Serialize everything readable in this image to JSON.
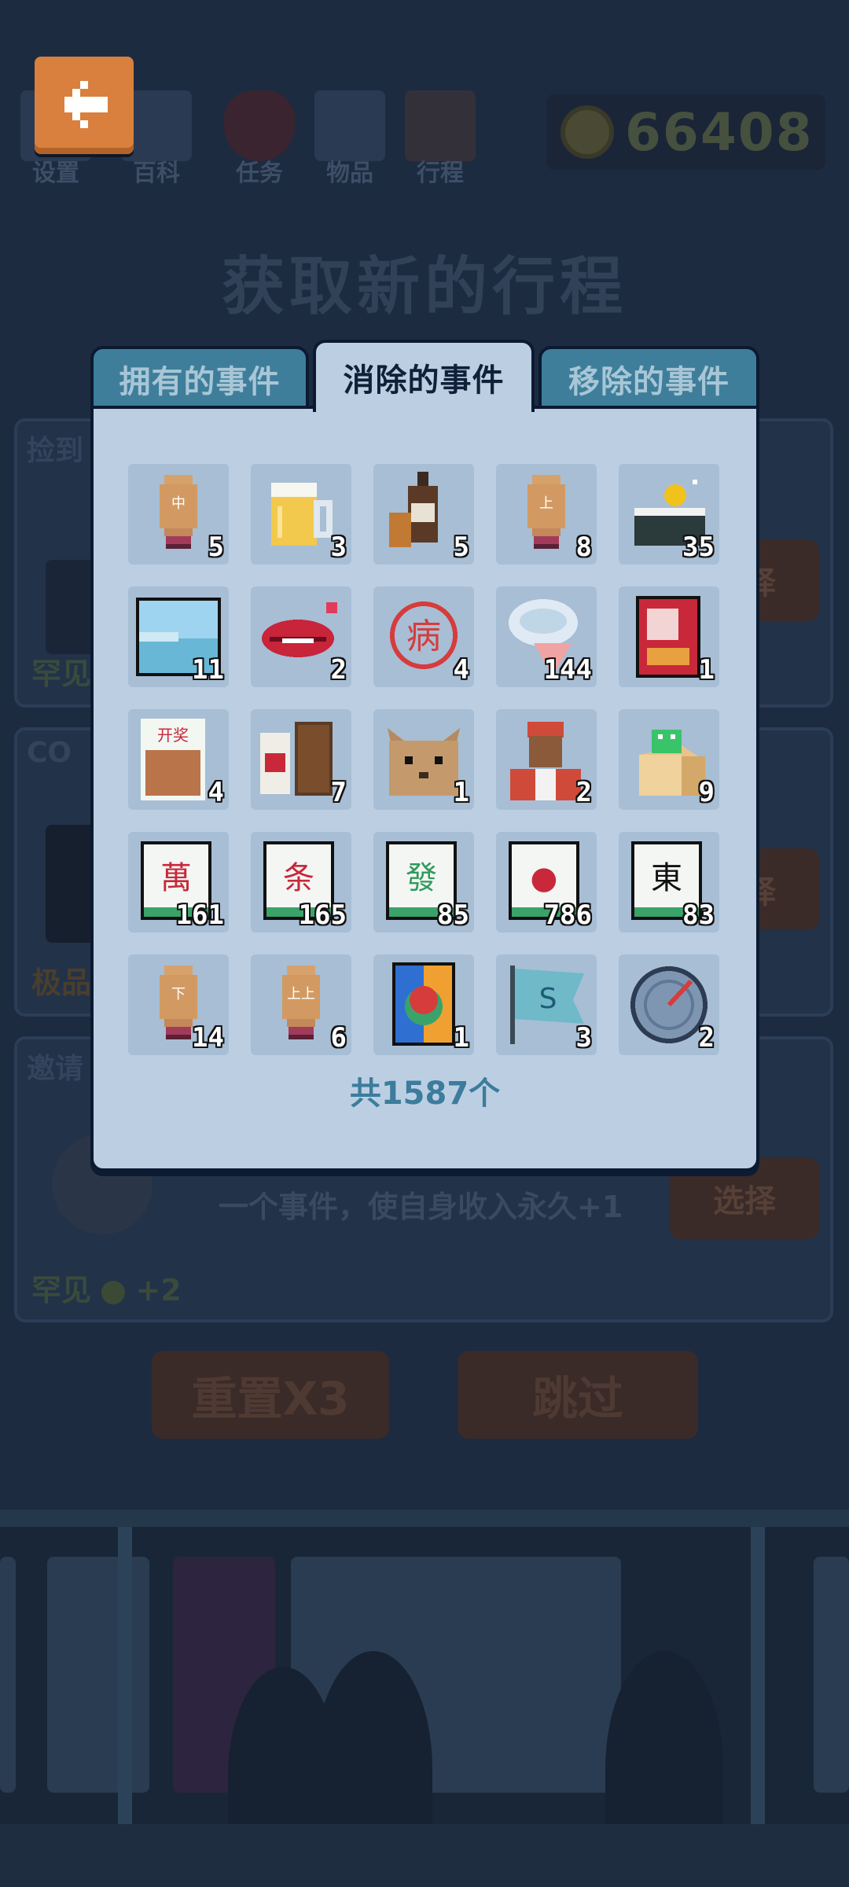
{
  "nav": [
    {
      "label": "设置",
      "icon": "settings-icon"
    },
    {
      "label": "百科",
      "icon": "encyclopedia-icon"
    },
    {
      "label": "任务",
      "icon": "task-heart-icon"
    },
    {
      "label": "物品",
      "icon": "items-icon"
    },
    {
      "label": "行程",
      "icon": "schedule-calendar-icon"
    }
  ],
  "coins": "66408",
  "page_title": "获取新的行程",
  "background": {
    "cards": [
      {
        "tag": "捡到",
        "rarity": "罕见",
        "select": "选择"
      },
      {
        "tag": "CO",
        "rarity": "极品",
        "select": "选择"
      },
      {
        "tag": "邀请",
        "rarity": "罕见",
        "bonus": "+2",
        "description": "一个事件，使自身收入永久+1",
        "select": "选择"
      }
    ],
    "reset_button": "重置X3",
    "skip_button": "跳过"
  },
  "modal": {
    "tabs": [
      {
        "label": "拥有的事件"
      },
      {
        "label": "消除的事件"
      },
      {
        "label": "移除的事件"
      }
    ],
    "active_tab": 1,
    "total": "共1587个",
    "items": [
      {
        "icon": "mahjong-chopstick-zhong-icon",
        "count": "5"
      },
      {
        "icon": "beer-mug-icon",
        "count": "3"
      },
      {
        "icon": "liquor-bottle-icon",
        "count": "5"
      },
      {
        "icon": "mahjong-chopstick-shang-icon",
        "count": "8"
      },
      {
        "icon": "coin-wallet-icon",
        "count": "35"
      },
      {
        "icon": "landscape-painting-icon",
        "count": "11"
      },
      {
        "icon": "red-lips-icon",
        "count": "2"
      },
      {
        "icon": "sick-stamp-icon",
        "count": "4"
      },
      {
        "icon": "ice-cream-cone-icon",
        "count": "144"
      },
      {
        "icon": "red-envelope-icon",
        "count": "1"
      },
      {
        "icon": "lottery-snack-bag-icon",
        "count": "4"
      },
      {
        "icon": "baijiu-gift-box-icon",
        "count": "7"
      },
      {
        "icon": "cat-face-icon",
        "count": "1"
      },
      {
        "icon": "delivery-man-icon",
        "count": "2"
      },
      {
        "icon": "frog-package-icon",
        "count": "9"
      },
      {
        "icon": "mahjong-tile-wan-icon",
        "count": "161"
      },
      {
        "icon": "mahjong-tile-tiao-icon",
        "count": "165"
      },
      {
        "icon": "mahjong-tile-fa-icon",
        "count": "85"
      },
      {
        "icon": "mahjong-tile-tong-icon",
        "count": "786"
      },
      {
        "icon": "mahjong-tile-dong-icon",
        "count": "83"
      },
      {
        "icon": "mahjong-chopstick-xia-icon",
        "count": "14"
      },
      {
        "icon": "mahjong-chopstick-shangshang-icon",
        "count": "6"
      },
      {
        "icon": "colorful-poster-icon",
        "count": "1"
      },
      {
        "icon": "blue-flag-icon",
        "count": "3"
      },
      {
        "icon": "speed-gauge-icon",
        "count": "2"
      }
    ]
  },
  "colors": {
    "back_button": "#d9803e",
    "tab_inactive": "#3e7e9b",
    "panel": "#bccfe2",
    "cell": "#a7bed5",
    "total_text": "#3c7c9c"
  }
}
